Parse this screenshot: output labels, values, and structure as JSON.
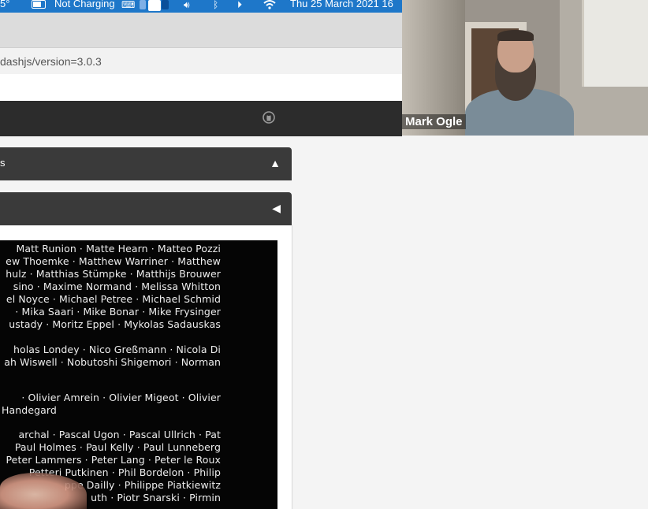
{
  "menubar": {
    "left_fragment": "5°",
    "battery_status": "Not Charging",
    "datetime": "Thu 25 March 2021 16"
  },
  "browser": {
    "url": "dashjs/version=3.0.3"
  },
  "site": {
    "github_icon": "github-icon"
  },
  "panels": [
    {
      "title_fragment": "s",
      "toggle": "▲"
    },
    {
      "toggle": "◀"
    }
  ],
  "video": {
    "credits": [
      "Matt Runion  ·  Matte Hearn  ·  Matteo Pozzi",
      "ew Thoemke  ·  Matthew Warriner  ·  Matthew",
      "hulz  ·  Matthias Stümpke  ·  Matthijs Brouwer",
      "sino  ·  Maxime Normand  ·  Melissa Whitton",
      "el Noyce  ·  Michael Petree  ·  Michael Schmid",
      "·  Mika Saari  ·  Mike Bonar  ·  Mike Frysinger",
      "ustady  ·  Moritz Eppel  ·  Mykolas Sadauskas",
      "holas Londey  ·  Nico Greßmann  ·  Nicola Di",
      "ah Wiswell  ·  Nobutoshi Shigemori  ·  Norman",
      "·  Olivier Amrein  ·  Olivier Migeot  ·  Olivier",
      "Handegard",
      "archal  ·  Pascal Ugon  ·  Pascal Ullrich  ·  Pat",
      "Paul Holmes  ·  Paul Kelly  ·  Paul Lunneberg",
      "Peter Lammers  ·  Peter Lang  ·  Peter le Roux",
      "Petteri Putkinen  ·  Phil Bordelon  ·  Philip",
      "ppe Dailly  ·  Philippe Piatkiewitz",
      "uth  ·  Piotr Snarski  ·  Pirmin"
    ]
  },
  "webcam": {
    "participant_name": "Mark Ogle"
  }
}
